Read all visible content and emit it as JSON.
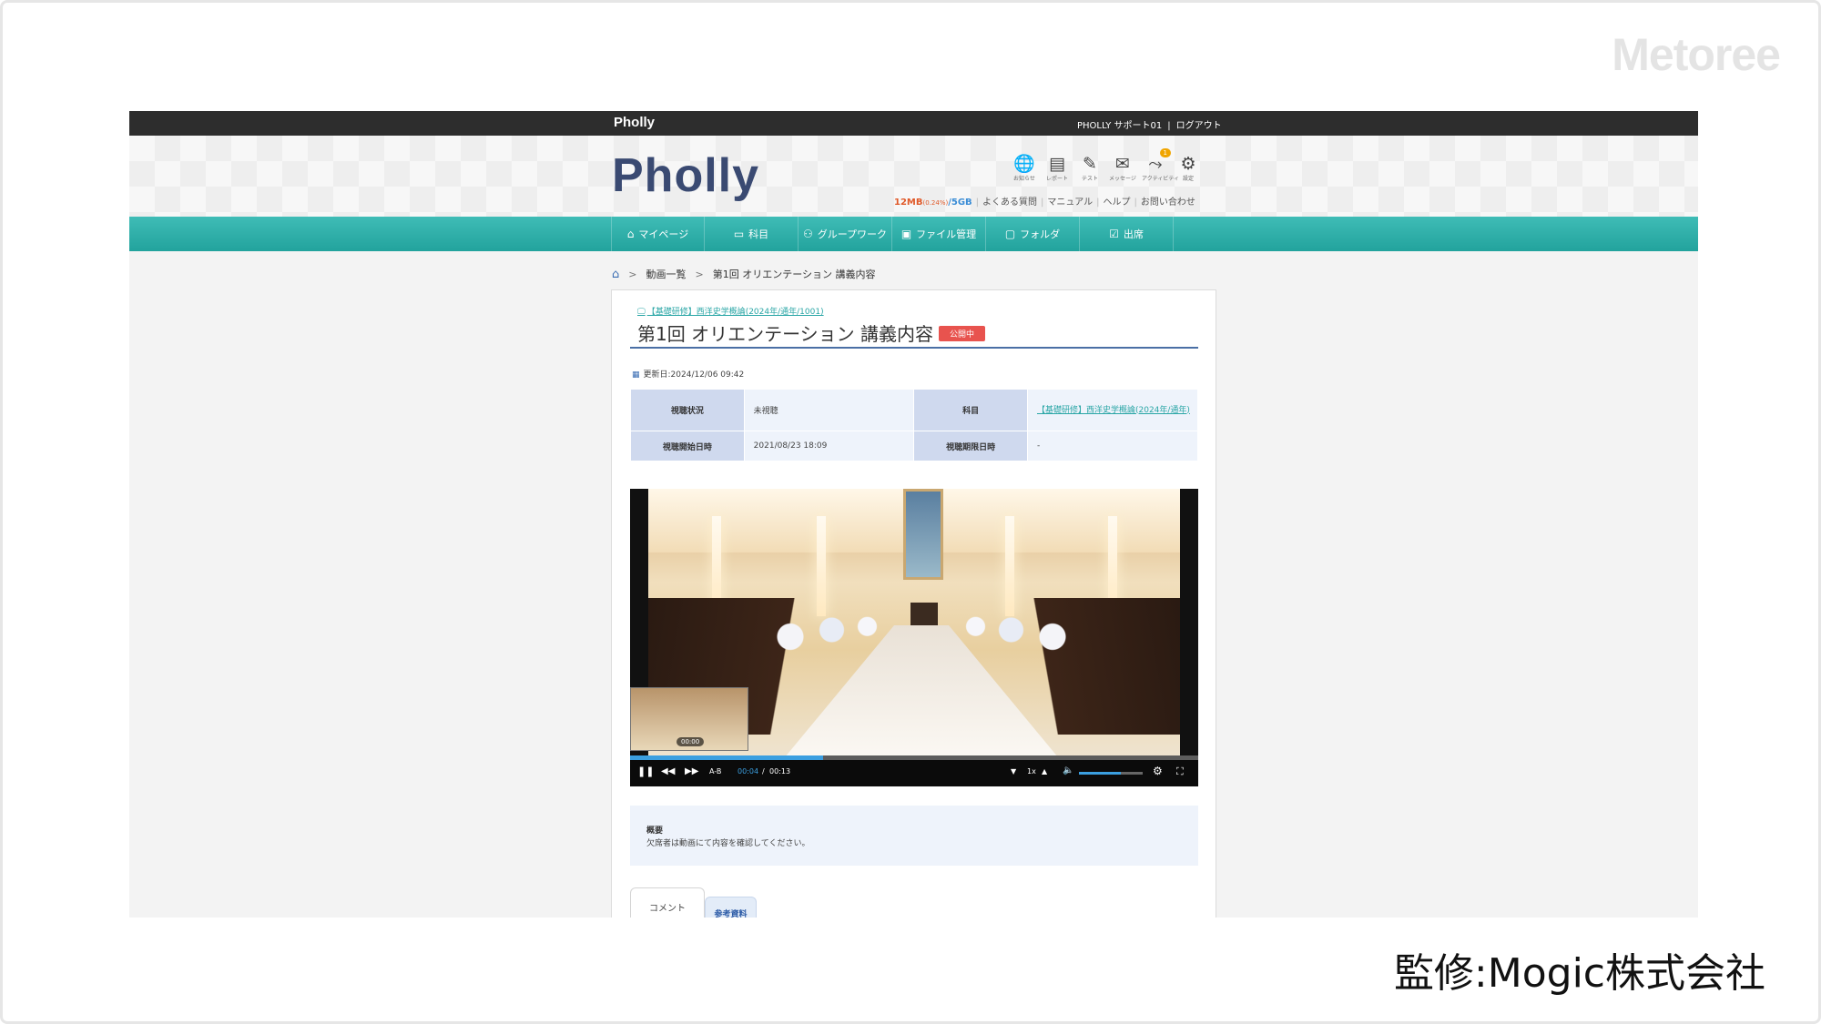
{
  "watermark": "Metoree",
  "credit": "監修:Mogic株式会社",
  "topbar": {
    "brand": "Pholly",
    "user": "PHOLLY サポート01",
    "separator": "|",
    "logout": "ログアウト"
  },
  "header": {
    "logo": "Pholly",
    "icons": [
      {
        "name": "globe-icon",
        "glyph": "🌐",
        "label": "お知らせ"
      },
      {
        "name": "report-icon",
        "glyph": "▤",
        "label": "レポート"
      },
      {
        "name": "test-icon",
        "glyph": "✎",
        "label": "テスト"
      },
      {
        "name": "mail-icon",
        "glyph": "✉",
        "label": "メッセージ"
      },
      {
        "name": "activity-icon",
        "glyph": "⤳",
        "label": "アクティビティ",
        "badge": "1"
      },
      {
        "name": "gear-icon",
        "glyph": "⚙",
        "label": "設定"
      }
    ],
    "quota_used": "12MB",
    "quota_pct": "(0.24%)",
    "quota_total": "/5GB",
    "links": [
      "よくある質問",
      "マニュアル",
      "ヘルプ",
      "お問い合わせ"
    ]
  },
  "nav": {
    "items": [
      {
        "label": "マイページ",
        "glyph": "⌂"
      },
      {
        "label": "科目",
        "glyph": "▭"
      },
      {
        "label": "グループワーク",
        "glyph": "⚇"
      },
      {
        "label": "ファイル管理",
        "glyph": "▣"
      },
      {
        "label": "フォルダ",
        "glyph": "▢"
      },
      {
        "label": "出席",
        "glyph": "☑"
      }
    ]
  },
  "breadcrumb": {
    "home_glyph": "⌂",
    "items": [
      "動画一覧",
      "第1回 オリエンテーション 講義内容"
    ]
  },
  "content": {
    "subject_link": "【基礎研修】西洋史学概論(2024年/通年/1001)",
    "title": "第1回 オリエンテーション 講義内容",
    "status_badge": "公開中",
    "updated": "更新日:2024/12/06 09:42",
    "info": {
      "watch_status_label": "視聴状況",
      "watch_status_value": "未視聴",
      "subject_label": "科目",
      "subject_value": "【基礎研修】西洋史学概論(2024年/通年)",
      "start_label": "視聴開始日時",
      "start_value": "2021/08/23 18:09",
      "deadline_label": "視聴期限日時",
      "deadline_value": "-"
    },
    "player": {
      "thumb_time": "00:00",
      "ab_label": "A-B",
      "current_time": "00:04",
      "time_sep": "/",
      "duration": "00:13",
      "speed": "1x",
      "progress_fraction": 0.34,
      "volume_fraction": 0.65
    },
    "summary_heading": "概要",
    "summary_text": "欠席者は動画にて内容を確認してください。",
    "tabs": [
      "コメント",
      "参考資料"
    ]
  }
}
